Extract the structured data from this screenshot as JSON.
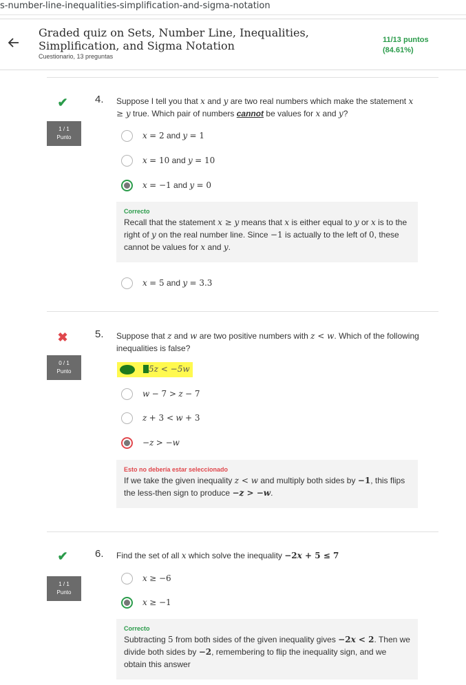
{
  "browser": {
    "url_fragment": "s-number-line-inequalities-simplification-and-sigma-notation"
  },
  "header": {
    "title": "Graded quiz on Sets, Number Line, Inequalities, Simplification, and Sigma Notation",
    "subtitle": "Cuestionario, 13 preguntas",
    "score_line1": "11/13 puntos",
    "score_line2": "(84.61%)"
  },
  "questions": [
    {
      "number": "4.",
      "badge_score": "1 / 1",
      "badge_label": "Punto",
      "status": "correct",
      "text_html": "Suppose I tell you that <span class='math'>x</span> and <span class='math'>y</span> are two real numbers which make the statement <span class='math'>x ≥ y</span> true. Which pair of numbers <b><i><u>cannot</u></i></b> be values for <span class='math'>x</span> and <span class='math'>y</span>?",
      "options": [
        {
          "label_html": "<span class='math'>x</span> <span class='mathr'>= 2</span> and <span class='math'>y</span> <span class='mathr'>= 1</span>",
          "state": "none"
        },
        {
          "label_html": "<span class='math'>x</span> <span class='mathr'>= 10</span> and <span class='math'>y</span> <span class='mathr'>= 10</span>",
          "state": "none"
        },
        {
          "label_html": "<span class='math'>x</span> <span class='mathr'>= −1</span> and <span class='math'>y</span> <span class='mathr'>= 0</span>",
          "state": "selected-correct"
        },
        {
          "label_html": "<span class='math'>x</span> <span class='mathr'>= 5</span> and <span class='math'>y</span> <span class='mathr'>= 3.3</span>",
          "state": "none"
        }
      ],
      "feedback": {
        "title": "Correcto",
        "body_html": "Recall that the statement <span class='math'>x ≥ y</span> means that <span class='math'>x</span> is either equal to <span class='math'>y</span> or <span class='math'>x</span> is to the right of <span class='math'>y</span> on the real number line. Since <span class='mathr'>−1</span> is actually to the left of <span class='mathr'>0</span>, these cannot be values for <span class='math'>x</span> and <span class='math'>y</span>."
      }
    },
    {
      "number": "5.",
      "badge_score": "0 / 1",
      "badge_label": "Punto",
      "status": "incorrect",
      "text_html": "Suppose that <span class='math'>z</span> and <span class='math'>w</span> are two positive numbers with <span class='math'>z &lt; w</span>. Which of the following inequalities is false?",
      "highlight_option": "5z < −5w",
      "options": [
        {
          "label_html": "<span class='math'>w</span> <span class='mathr'>− 7 &gt;</span> <span class='math'>z</span> <span class='mathr'>− 7</span>",
          "state": "none"
        },
        {
          "label_html": "<span class='math'>z</span> <span class='mathr'>+ 3 &lt;</span> <span class='math'>w</span> <span class='mathr'>+ 3</span>",
          "state": "none"
        },
        {
          "label_html": "<span class='mathr'>−</span><span class='math'>z</span> <span class='mathr'>&gt; −</span><span class='math'>w</span>",
          "state": "selected-wrong"
        }
      ],
      "feedback": {
        "title": "Esto no debería estar seleccionado",
        "body_html": "If we take the given inequality <span class='math'>z &lt; w</span> and multiply both sides by <b class='mathr'>−1</b>, this flips the less-then sign to produce <b class='math'>−z &gt; −w</b>."
      }
    },
    {
      "number": "6.",
      "badge_score": "1 / 1",
      "badge_label": "Punto",
      "status": "correct",
      "text_html": "Find the set of all <span class='math'>x</span> which solve the inequality <b class='mathr'>−2<i>x</i> + 5 ≤ 7</b>",
      "options": [
        {
          "label_html": "<span class='math'>x</span> <span class='mathr'>≥ −6</span>",
          "state": "none"
        },
        {
          "label_html": "<span class='math'>x</span> <span class='mathr'>≥ −1</span>",
          "state": "selected-correct"
        }
      ],
      "feedback": {
        "title": "Correcto",
        "body_html": "Subtracting <span class='mathr'>5</span> from both sides of the given inequality gives <b class='mathr'>−2<i>x</i> &lt; 2</b>. Then we divide both sides by <b class='mathr'>−2</b>, remembering to flip the inequality sign, and we obtain this answer"
      }
    }
  ]
}
